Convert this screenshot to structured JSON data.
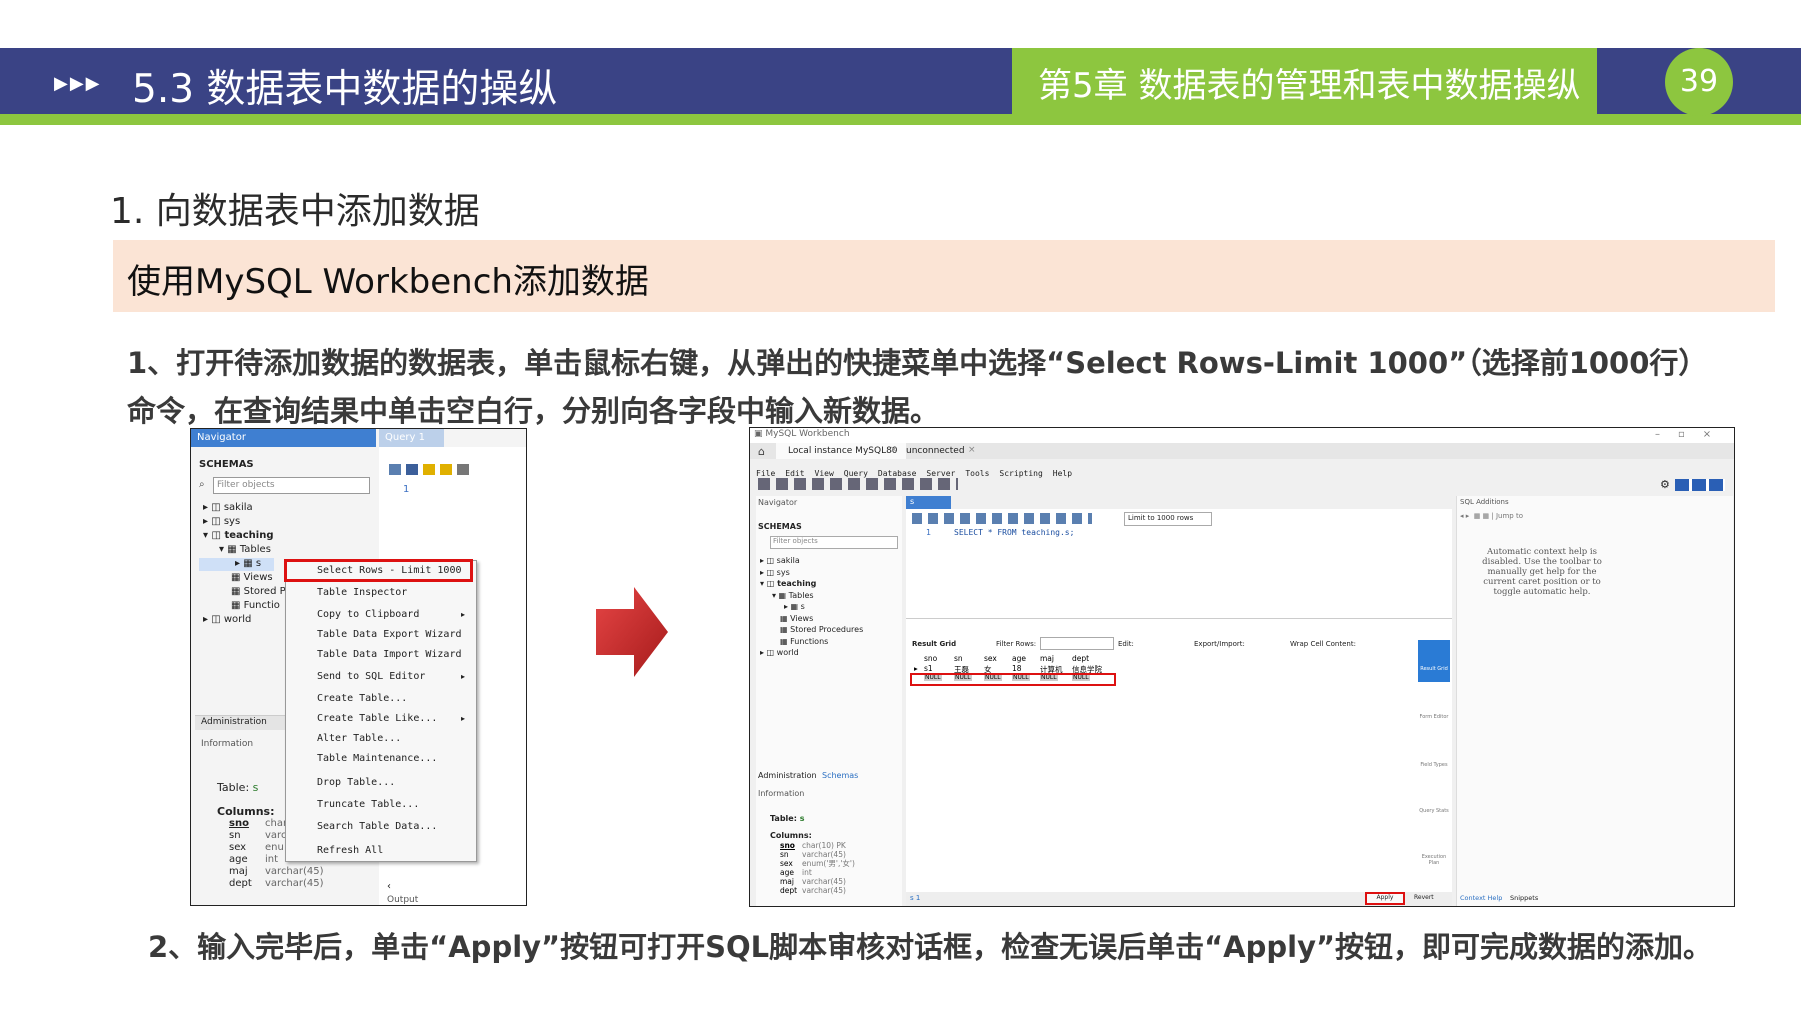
{
  "header": {
    "arrows": "▶▶▶",
    "title": "5.3 数据表中数据的操纵",
    "chapter": "第5章 数据表的管理和表中数据操纵",
    "page": "39"
  },
  "section_title": "1. 向数据表中添加数据",
  "banner": "使用MySQL Workbench添加数据",
  "step1_line1": "1、打开待添加数据的数据表，单击鼠标右键，从弹出的快捷菜单中选择“Select Rows-Limit 1000”（选择前1000行）",
  "step1_line2": "命令，在查询结果中单击空白行，分别向各字段中输入新数据。",
  "step2": "2、输入完毕后，单击“Apply”按钮可打开SQL脚本审核对话框，检查无误后单击“Apply”按钮，即可完成数据的添加。",
  "shot1": {
    "navigator": "Navigator",
    "query_tab": "Query 1",
    "schemas": "SCHEMAS",
    "filter": "Filter objects",
    "line_no": "1",
    "tree": [
      "sakila",
      "sys",
      "teaching",
      "Tables",
      "s",
      "Views",
      "Stored P",
      "Functio",
      "world"
    ],
    "menu": [
      "Select Rows - Limit 1000",
      "Table Inspector",
      "Copy to Clipboard",
      "Table Data Export Wizard",
      "Table Data Import Wizard",
      "Send to SQL Editor",
      "Create Table...",
      "Create Table Like...",
      "Alter Table...",
      "Table Maintenance...",
      "Drop Table...",
      "Truncate Table...",
      "Search Table Data...",
      "Refresh All"
    ],
    "admin_tab": "Administration",
    "info": "Information",
    "table_label": "Table:",
    "table_name": "s",
    "columns_label": "Columns:",
    "columns": [
      [
        "sno",
        "char"
      ],
      [
        "sn",
        "varc"
      ],
      [
        "sex",
        "enu"
      ],
      [
        "age",
        "int"
      ],
      [
        "maj",
        "varchar(45)"
      ],
      [
        "dept",
        "varchar(45)"
      ]
    ],
    "output": "Output"
  },
  "shot2": {
    "app_title": "MySQL Workbench",
    "tab_local": "Local instance MySQL80",
    "tab_unconnected": "unconnected",
    "menubar": [
      "File",
      "Edit",
      "View",
      "Query",
      "Database",
      "Server",
      "Tools",
      "Scripting",
      "Help"
    ],
    "navigator": "Navigator",
    "schemas": "SCHEMAS",
    "filter": "Filter objects",
    "tree": [
      "sakila",
      "sys",
      "teaching",
      "Tables",
      "s",
      "Views",
      "Stored Procedures",
      "Functions",
      "world"
    ],
    "admin_tab": "Administration",
    "schemas_tab": "Schemas",
    "info": "Information",
    "table_label": "Table:",
    "table_name": "s",
    "columns_label": "Columns:",
    "columns": [
      [
        "sno",
        "char(10) PK"
      ],
      [
        "sn",
        "varchar(45)"
      ],
      [
        "sex",
        "enum('男','女')"
      ],
      [
        "age",
        "int"
      ],
      [
        "maj",
        "varchar(45)"
      ],
      [
        "dept",
        "varchar(45)"
      ]
    ],
    "editor_tab": "s",
    "limit": "Limit to 1000 rows",
    "sql_line_no": "1",
    "sql": "SELECT * FROM teaching.s;",
    "result_grid": "Result Grid",
    "filter_rows": "Filter Rows:",
    "edit": "Edit:",
    "export_import": "Export/Import:",
    "wrap": "Wrap Cell Content:",
    "grid_headers": [
      "sno",
      "sn",
      "sex",
      "age",
      "maj",
      "dept"
    ],
    "grid_row": [
      "s1",
      "王磊",
      "女",
      "18",
      "计算机",
      "信息学院"
    ],
    "null_cell": "NULL",
    "side_buttons": [
      "Result Grid",
      "Form Editor",
      "Field Types",
      "Query Stats",
      "Execution Plan"
    ],
    "sql_additions": "SQL Additions",
    "jump_to": "Jump to",
    "help_text": [
      "Automatic context help is",
      "disabled. Use the toolbar to",
      "manually get help for the",
      "current caret position or to",
      "toggle automatic help."
    ],
    "result_tab": "s 1",
    "apply": "Apply",
    "revert": "Revert",
    "context_help": "Context Help",
    "snippets": "Snippets"
  }
}
